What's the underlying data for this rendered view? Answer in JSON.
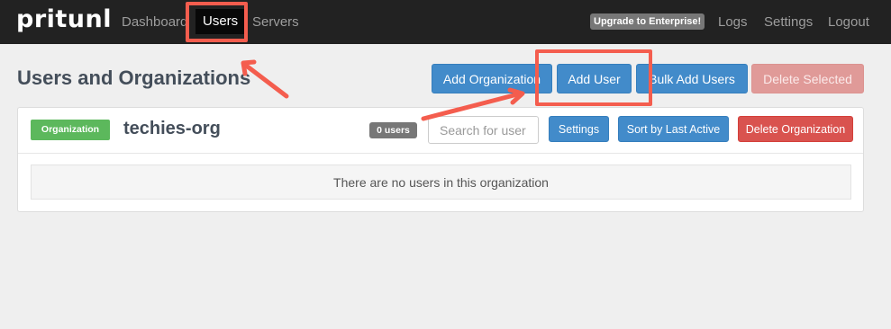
{
  "navbar": {
    "brand": "pritunl",
    "links": [
      "Dashboard",
      "Users",
      "Servers"
    ],
    "upgrade": "Upgrade to Enterprise!",
    "right_links": [
      "Logs",
      "Settings",
      "Logout"
    ]
  },
  "page": {
    "title": "Users and Organizations",
    "buttons": {
      "add_organization": "Add Organization",
      "add_user": "Add User",
      "bulk_add_users": "Bulk Add Users",
      "delete_selected": "Delete Selected"
    }
  },
  "organization": {
    "label": "Organization",
    "name": "techies-org",
    "users_badge": "0 users",
    "search_placeholder": "Search for user",
    "buttons": {
      "settings": "Settings",
      "sort": "Sort by Last Active",
      "delete": "Delete Organization"
    },
    "empty_message": "There are no users in this organization"
  },
  "colors": {
    "navbar_bg": "#222222",
    "primary": "#428bca",
    "danger": "#d9534f",
    "success": "#5cb85c",
    "annotation": "#f45d4e"
  },
  "annotations": {
    "highlights": [
      "users-tab-highlight",
      "add-user-highlight"
    ],
    "arrows": [
      "arrow-to-users-tab",
      "arrow-to-add-user"
    ]
  }
}
